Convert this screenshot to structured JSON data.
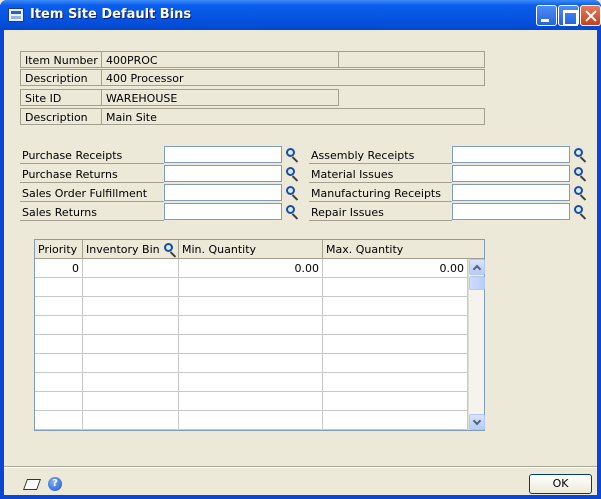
{
  "window": {
    "title": "Item Site Default Bins",
    "controls": [
      "minimize-icon",
      "maximize-icon",
      "close-icon"
    ]
  },
  "item": {
    "item_number_label": "Item Number",
    "item_number": "400PROC",
    "description_label": "Description",
    "description": "400 Processor",
    "site_id_label": "Site ID",
    "site_id": "WAREHOUSE",
    "site_description_label": "Description",
    "site_description": "Main Site"
  },
  "bins_left": [
    {
      "label": "Purchase Receipts",
      "value": ""
    },
    {
      "label": "Purchase Returns",
      "value": ""
    },
    {
      "label": "Sales Order Fulfillment",
      "value": ""
    },
    {
      "label": "Sales Returns",
      "value": ""
    }
  ],
  "bins_right": [
    {
      "label": "Assembly Receipts",
      "value": ""
    },
    {
      "label": "Material Issues",
      "value": ""
    },
    {
      "label": "Manufacturing Receipts",
      "value": ""
    },
    {
      "label": "Repair Issues",
      "value": ""
    }
  ],
  "grid": {
    "headers": {
      "priority": "Priority",
      "inventory_bin": "Inventory Bin",
      "min_quantity": "Min. Quantity",
      "max_quantity": "Max. Quantity"
    },
    "rows": [
      {
        "priority": "0",
        "inventory_bin": "",
        "min_quantity": "0.00",
        "max_quantity": "0.00"
      }
    ]
  },
  "footer": {
    "ok_label": "OK",
    "help_glyph": "?"
  }
}
